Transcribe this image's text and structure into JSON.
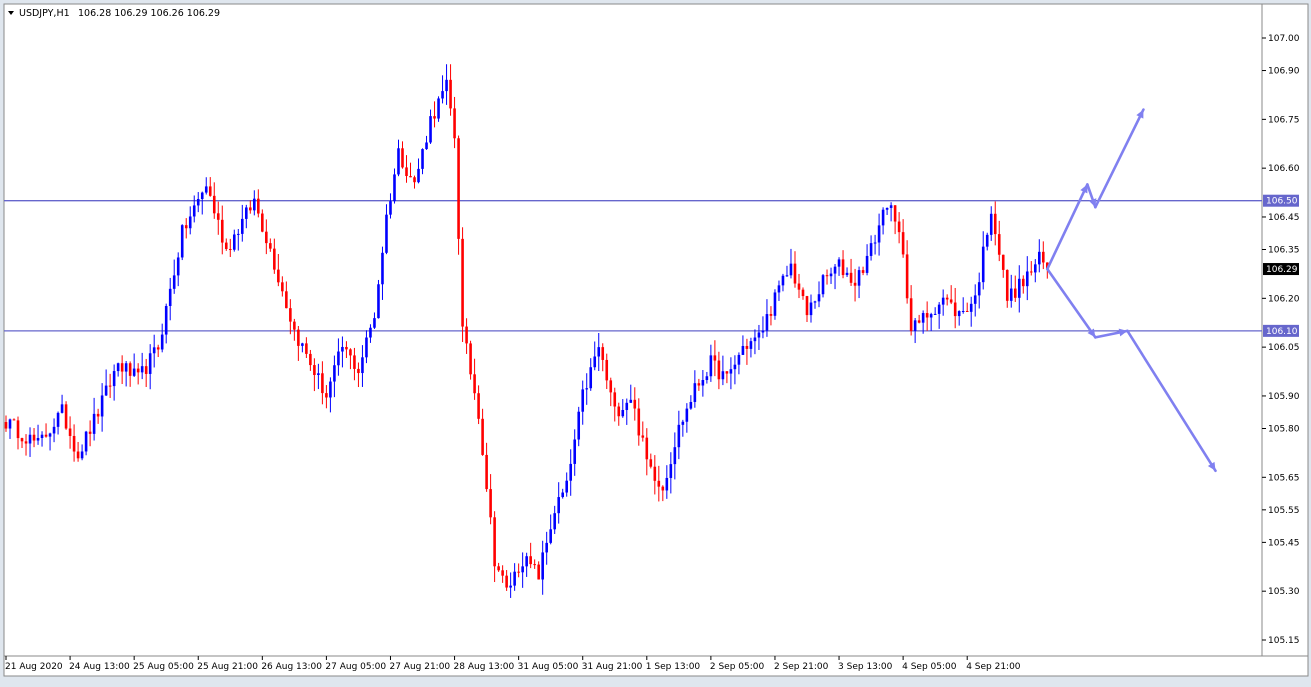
{
  "chart_data": {
    "type": "candlestick",
    "symbol": "USDJPY,H1",
    "ohlc_header": "106.28 106.29 106.26 106.29",
    "y_ticks": [
      "107.00",
      "106.90",
      "106.75",
      "106.60",
      "106.45",
      "106.35",
      "106.20",
      "106.05",
      "105.90",
      "105.80",
      "105.65",
      "105.55",
      "105.45",
      "105.30",
      "105.15"
    ],
    "ylim": [
      105.1,
      107.08
    ],
    "x_ticks": [
      "21 Aug 2020",
      "24 Aug 13:00",
      "25 Aug 05:00",
      "25 Aug 21:00",
      "26 Aug 13:00",
      "27 Aug 05:00",
      "27 Aug 21:00",
      "28 Aug 13:00",
      "31 Aug 05:00",
      "31 Aug 21:00",
      "1 Sep 13:00",
      "2 Sep 05:00",
      "2 Sep 21:00",
      "3 Sep 13:00",
      "4 Sep 05:00",
      "4 Sep 21:00"
    ],
    "horizontal_levels": [
      {
        "value": 106.5,
        "label": "106.50"
      },
      {
        "value": 106.1,
        "label": "106.10"
      }
    ],
    "current_price": {
      "value": 106.29,
      "label": "106.29"
    },
    "colors": {
      "bull": "#0000ff",
      "bear": "#ff0000",
      "level": "#6666cc",
      "arrow": "#8080f0",
      "grid": "#ffffff"
    },
    "anchors": [
      [
        0,
        105.82
      ],
      [
        8,
        105.75
      ],
      [
        14,
        105.85
      ],
      [
        18,
        105.72
      ],
      [
        23,
        105.85
      ],
      [
        28,
        106.0
      ],
      [
        33,
        105.95
      ],
      [
        38,
        106.05
      ],
      [
        44,
        106.4
      ],
      [
        50,
        106.55
      ],
      [
        55,
        106.35
      ],
      [
        62,
        106.5
      ],
      [
        66,
        106.35
      ],
      [
        72,
        106.1
      ],
      [
        76,
        106.0
      ],
      [
        80,
        105.9
      ],
      [
        84,
        106.05
      ],
      [
        88,
        105.98
      ],
      [
        92,
        106.15
      ],
      [
        95,
        106.45
      ],
      [
        98,
        106.65
      ],
      [
        102,
        106.55
      ],
      [
        106,
        106.75
      ],
      [
        110,
        106.85
      ],
      [
        112,
        106.7
      ],
      [
        114,
        106.1
      ],
      [
        118,
        105.85
      ],
      [
        122,
        105.4
      ],
      [
        125,
        105.3
      ],
      [
        129,
        105.4
      ],
      [
        133,
        105.35
      ],
      [
        137,
        105.55
      ],
      [
        140,
        105.62
      ],
      [
        144,
        105.9
      ],
      [
        148,
        106.05
      ],
      [
        152,
        105.85
      ],
      [
        156,
        105.9
      ],
      [
        160,
        105.7
      ],
      [
        164,
        105.62
      ],
      [
        168,
        105.8
      ],
      [
        172,
        105.92
      ],
      [
        176,
        106.0
      ],
      [
        180,
        105.95
      ],
      [
        184,
        106.05
      ],
      [
        188,
        106.08
      ],
      [
        192,
        106.2
      ],
      [
        196,
        106.3
      ],
      [
        200,
        106.15
      ],
      [
        204,
        106.25
      ],
      [
        208,
        106.3
      ],
      [
        212,
        106.25
      ],
      [
        216,
        106.35
      ],
      [
        220,
        106.5
      ],
      [
        224,
        106.35
      ],
      [
        226,
        106.1
      ],
      [
        230,
        106.15
      ],
      [
        234,
        106.2
      ],
      [
        238,
        106.15
      ],
      [
        242,
        106.2
      ],
      [
        246,
        106.48
      ],
      [
        250,
        106.2
      ],
      [
        254,
        106.25
      ],
      [
        258,
        106.32
      ],
      [
        260,
        106.29
      ]
    ],
    "scenario_paths": [
      [
        [
          106.29,
          0
        ],
        [
          106.55,
          10
        ],
        [
          106.48,
          12
        ],
        [
          106.78,
          24
        ]
      ],
      [
        [
          106.29,
          0
        ],
        [
          106.08,
          12
        ],
        [
          106.1,
          20
        ],
        [
          105.67,
          42
        ]
      ]
    ]
  }
}
